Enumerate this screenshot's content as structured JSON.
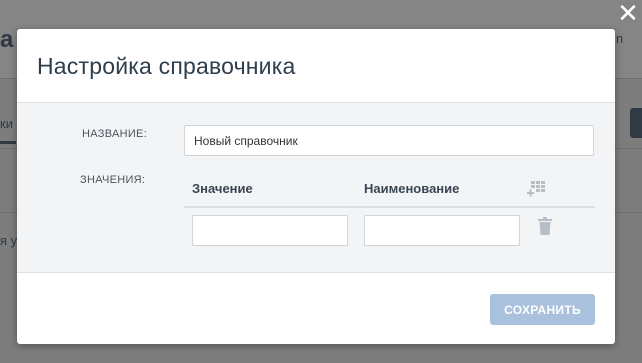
{
  "background": {
    "page_title_fragment": "a",
    "right_text_fragment": "n",
    "tab_fragment": "ки",
    "row_text_fragment": "я у"
  },
  "modal": {
    "title": "Настройка справочника",
    "name_label": "НАЗВАНИЕ:",
    "name_value": "Новый справочник",
    "values_label": "ЗНАЧЕНИЯ:",
    "columns": [
      "Значение",
      "Наименование"
    ],
    "rows": [
      {
        "value": "",
        "name": ""
      }
    ],
    "save_label": "СОХРАНИТЬ"
  },
  "colors": {
    "overlay": "#7d7d7d",
    "title_text": "#2f3e4d",
    "save_button_disabled": "#a9c1dd",
    "body_background": "#f3f4f5"
  },
  "icons": {
    "close": "close-icon",
    "add_row": "add-row-icon",
    "delete_row": "trash-icon"
  }
}
